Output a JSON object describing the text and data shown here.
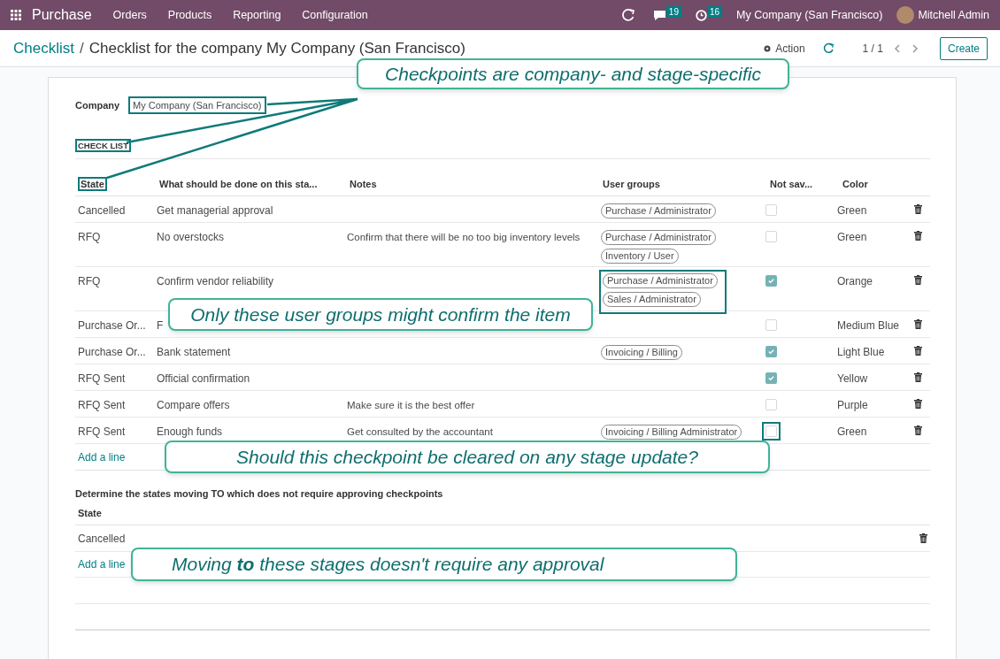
{
  "navbar": {
    "app_name": "Purchase",
    "menu": [
      "Orders",
      "Products",
      "Reporting",
      "Configuration"
    ],
    "chat_count": "19",
    "activity_count": "16",
    "company": "My Company (San Francisco)",
    "user": "Mitchell Admin"
  },
  "control_panel": {
    "breadcrumb_parent": "Checklist",
    "breadcrumb_separator": "/",
    "breadcrumb_current": "Checklist for the company My Company (San Francisco)",
    "action": "Action",
    "pager": "1 / 1",
    "create": "Create"
  },
  "form": {
    "company_label": "Company",
    "company_value": "My Company (San Francisco)",
    "company_highlighted": true,
    "checklist_label": "CHECK LIST",
    "checklist_highlighted": true,
    "columns": [
      {
        "label": "State",
        "highlighted": true
      },
      {
        "label": "What should be done on this sta...",
        "highlighted": false
      },
      {
        "label": "Notes",
        "highlighted": false
      },
      {
        "label": "User groups",
        "highlighted": false
      },
      {
        "label": "Not sav...",
        "highlighted": false
      },
      {
        "label": "Color",
        "highlighted": false
      }
    ],
    "rows": [
      {
        "state": "Cancelled",
        "action": "Get managerial approval",
        "notes": "",
        "groups": [
          "Purchase / Administrator"
        ],
        "groups_highlighted": false,
        "not_saved": false,
        "not_saved_highlighted": false,
        "color_name": "Green"
      },
      {
        "state": "RFQ",
        "action": "No overstocks",
        "notes": "Confirm that there will be no too big inventory levels",
        "groups": [
          "Purchase / Administrator",
          "Inventory / User"
        ],
        "groups_highlighted": false,
        "not_saved": false,
        "not_saved_highlighted": false,
        "color_name": "Green"
      },
      {
        "state": "RFQ",
        "action": "Confirm vendor reliability",
        "notes": "",
        "groups": [
          "Purchase / Administrator",
          "Sales / Administrator"
        ],
        "groups_highlighted": true,
        "not_saved": true,
        "not_saved_highlighted": false,
        "color_name": "Orange"
      },
      {
        "state": "Purchase Or...",
        "action": "F",
        "notes": "",
        "groups": [],
        "groups_highlighted": false,
        "not_saved": false,
        "not_saved_highlighted": false,
        "color_name": "Medium Blue"
      },
      {
        "state": "Purchase Or...",
        "action": "Bank statement",
        "notes": "",
        "groups": [
          "Invoicing / Billing"
        ],
        "groups_highlighted": false,
        "not_saved": true,
        "not_saved_highlighted": false,
        "color_name": "Light Blue"
      },
      {
        "state": "RFQ Sent",
        "action": "Official confirmation",
        "notes": "",
        "groups": [],
        "groups_highlighted": false,
        "not_saved": true,
        "not_saved_highlighted": false,
        "color_name": "Yellow"
      },
      {
        "state": "RFQ Sent",
        "action": "Compare offers",
        "notes": "Make sure it is the best offer",
        "groups": [],
        "groups_highlighted": false,
        "not_saved": false,
        "not_saved_highlighted": false,
        "color_name": "Purple"
      },
      {
        "state": "RFQ Sent",
        "action": "Enough funds",
        "notes": "Get consulted by the accountant",
        "groups": [
          "Invoicing / Billing Administrator"
        ],
        "groups_highlighted": false,
        "not_saved": false,
        "not_saved_highlighted": true,
        "color_name": "Green"
      }
    ],
    "add_line": "Add a line",
    "section_title": "Determine the states moving TO which does not require approving checkpoints",
    "section_column": "State",
    "section_rows": [
      "Cancelled"
    ],
    "section_add_line": "Add a line"
  },
  "callouts": [
    {
      "text": "Checkpoints are company- and stage-specific"
    },
    {
      "text": "Only these user groups might confirm the item"
    },
    {
      "text": "Should this checkpoint be cleared on any stage update?"
    },
    {
      "text": "Moving **to** these stages doesn't require any approval"
    }
  ]
}
